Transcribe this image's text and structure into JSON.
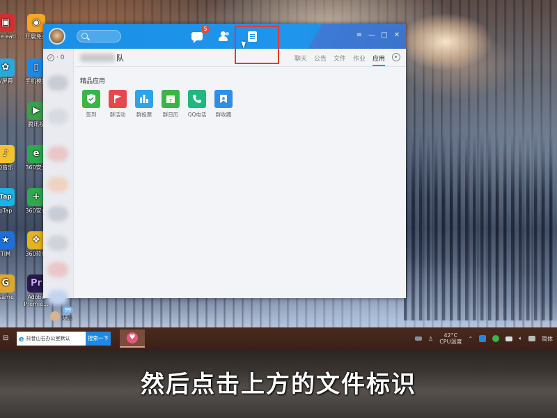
{
  "desktop": {
    "icons": [
      {
        "label": "dobe eati...",
        "color": "#d32f2f",
        "glyph": "▣"
      },
      {
        "label": "开晨免费",
        "color": "#f5a623",
        "glyph": "◉"
      },
      {
        "label": "V屏幕",
        "color": "#29a8e0",
        "glyph": "✿"
      },
      {
        "label": "手机模拟",
        "color": "#1e88e5",
        "glyph": "▯"
      },
      {
        "label": "腾讯视",
        "color": "#3aa04a",
        "glyph": "▶"
      },
      {
        "label": "Q音乐",
        "color": "#f2c230",
        "glyph": "♪"
      },
      {
        "label": "360安全",
        "color": "#2fa84f",
        "glyph": "e"
      },
      {
        "label": "pTap",
        "color": "#18b4e6",
        "glyph": "Tap"
      },
      {
        "label": "360安全",
        "color": "#2fa84f",
        "glyph": "+"
      },
      {
        "label": "TIM",
        "color": "#1e6fd9",
        "glyph": "★"
      },
      {
        "label": "360软件",
        "color": "#e6b222",
        "glyph": "❖"
      },
      {
        "label": "Game",
        "color": "#e0a82a",
        "glyph": "G"
      },
      {
        "label": "Adobe Premie...",
        "color": "#2a1a4a",
        "glyph": "Pr"
      }
    ]
  },
  "qq": {
    "message_badge": "5",
    "left": {
      "check_label": "· 0",
      "bottom_label": "优酷",
      "bottom_badge": "99"
    },
    "group": {
      "name_visible": "队",
      "tabs": [
        "聊天",
        "公告",
        "文件",
        "作业",
        "应用"
      ],
      "active_tab": "应用"
    },
    "apps": {
      "section_title": "精品应用",
      "items": [
        {
          "label": "签到",
          "color": "#3bb54a",
          "icon": "check-shield-icon"
        },
        {
          "label": "群活动",
          "color": "#e5484d",
          "icon": "flag-icon"
        },
        {
          "label": "群投票",
          "color": "#2fa3e6",
          "icon": "bar-chart-icon"
        },
        {
          "label": "群日历",
          "color": "#3bb54a",
          "icon": "calendar-icon"
        },
        {
          "label": "QQ电话",
          "color": "#1fb97e",
          "icon": "phone-icon"
        },
        {
          "label": "群收藏",
          "color": "#2f8fe6",
          "icon": "bookmark-icon"
        }
      ]
    }
  },
  "taskbar": {
    "search_text": "抖音山石办公室默认",
    "search_button": "搜索一下",
    "cpu_temp": "42°C",
    "cpu_label": "CPU温度",
    "ime": "简体"
  },
  "subtitle": "然后点击上方的文件标识"
}
